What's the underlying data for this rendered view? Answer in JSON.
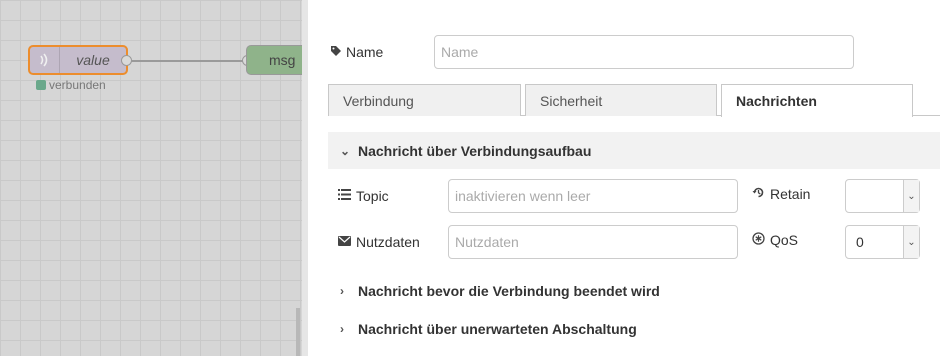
{
  "workspace": {
    "node_value_label": "value",
    "node_value_icon": "radio-waves-icon",
    "node_msg_label": "msg",
    "status_text": "verbunden",
    "status_color": "#6aa88b",
    "node_value_color": "#c5bccc",
    "node_selected_border": "#ec8d2d",
    "node_msg_color": "#8fb38a"
  },
  "panel": {
    "name": {
      "label": "Name",
      "icon": "tag-icon",
      "placeholder": "Name",
      "value": ""
    },
    "tabs": [
      {
        "label": "Verbindung",
        "active": false
      },
      {
        "label": "Sicherheit",
        "active": false
      },
      {
        "label": "Nachrichten",
        "active": true
      }
    ],
    "sections": [
      {
        "title": "Nachricht über Verbindungsaufbau",
        "expanded": true,
        "chevron": "⌄"
      },
      {
        "title": "Nachricht bevor die Verbindung beendet wird",
        "expanded": false,
        "chevron": "›"
      },
      {
        "title": "Nachricht über unerwarteten Abschaltung",
        "expanded": false,
        "chevron": "›"
      }
    ],
    "topic": {
      "label": "Topic",
      "icon": "list-icon",
      "placeholder": "inaktivieren wenn leer",
      "value": ""
    },
    "payload": {
      "label": "Nutzdaten",
      "icon": "envelope-icon",
      "placeholder": "Nutzdaten",
      "value": ""
    },
    "retain": {
      "label": "Retain",
      "icon": "history-icon",
      "value": ""
    },
    "qos": {
      "label": "QoS",
      "icon": "asterisk-circle-icon",
      "value": "0"
    }
  }
}
